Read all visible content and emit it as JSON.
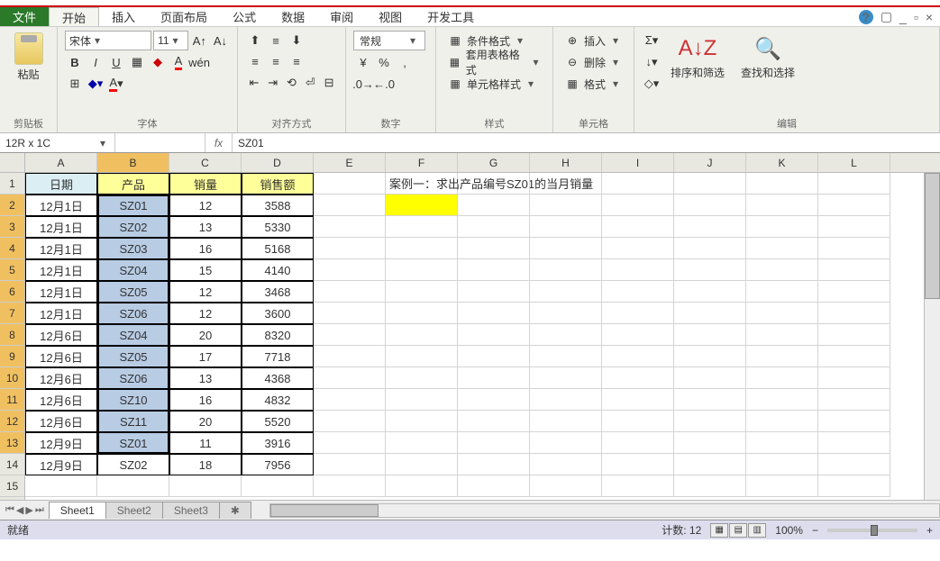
{
  "menu": {
    "file": "文件",
    "tabs": [
      "开始",
      "插入",
      "页面布局",
      "公式",
      "数据",
      "审阅",
      "视图",
      "开发工具"
    ],
    "active": 0
  },
  "ribbon": {
    "clipboard": {
      "label": "剪贴板",
      "paste": "粘贴"
    },
    "font": {
      "label": "字体",
      "name": "宋体",
      "size": "11"
    },
    "align": {
      "label": "对齐方式"
    },
    "number": {
      "label": "数字",
      "format": "常规"
    },
    "styles": {
      "label": "样式",
      "cond": "条件格式",
      "table": "套用表格格式",
      "cell": "单元格样式"
    },
    "cells": {
      "label": "单元格",
      "insert": "插入",
      "delete": "删除",
      "format": "格式"
    },
    "editing": {
      "label": "编辑",
      "sort": "排序和筛选",
      "find": "查找和选择"
    }
  },
  "formula": {
    "namebox": "12R x 1C",
    "fx": "fx",
    "value": "SZ01"
  },
  "columns": [
    "A",
    "B",
    "C",
    "D",
    "E",
    "F",
    "G",
    "H",
    "I",
    "J",
    "K",
    "L"
  ],
  "rows": [
    "1",
    "2",
    "3",
    "4",
    "5",
    "6",
    "7",
    "8",
    "9",
    "10",
    "11",
    "12",
    "13",
    "14",
    "15"
  ],
  "headers": {
    "A": "日期",
    "B": "产品",
    "C": "销量",
    "D": "销售额"
  },
  "note": "案例一：求出产品编号SZ01的当月销量",
  "data": [
    {
      "d": "12月1日",
      "p": "SZ01",
      "q": "12",
      "s": "3588"
    },
    {
      "d": "12月1日",
      "p": "SZ02",
      "q": "13",
      "s": "5330"
    },
    {
      "d": "12月1日",
      "p": "SZ03",
      "q": "16",
      "s": "5168"
    },
    {
      "d": "12月1日",
      "p": "SZ04",
      "q": "15",
      "s": "4140"
    },
    {
      "d": "12月1日",
      "p": "SZ05",
      "q": "12",
      "s": "3468"
    },
    {
      "d": "12月1日",
      "p": "SZ06",
      "q": "12",
      "s": "3600"
    },
    {
      "d": "12月6日",
      "p": "SZ04",
      "q": "20",
      "s": "8320"
    },
    {
      "d": "12月6日",
      "p": "SZ05",
      "q": "17",
      "s": "7718"
    },
    {
      "d": "12月6日",
      "p": "SZ06",
      "q": "13",
      "s": "4368"
    },
    {
      "d": "12月6日",
      "p": "SZ10",
      "q": "16",
      "s": "4832"
    },
    {
      "d": "12月6日",
      "p": "SZ11",
      "q": "20",
      "s": "5520"
    },
    {
      "d": "12月9日",
      "p": "SZ01",
      "q": "11",
      "s": "3916"
    },
    {
      "d": "12月9日",
      "p": "SZ02",
      "q": "18",
      "s": "7956"
    }
  ],
  "sheets": [
    "Sheet1",
    "Sheet2",
    "Sheet3"
  ],
  "status": {
    "ready": "就绪",
    "count": "计数: 12",
    "zoom": "100%"
  }
}
